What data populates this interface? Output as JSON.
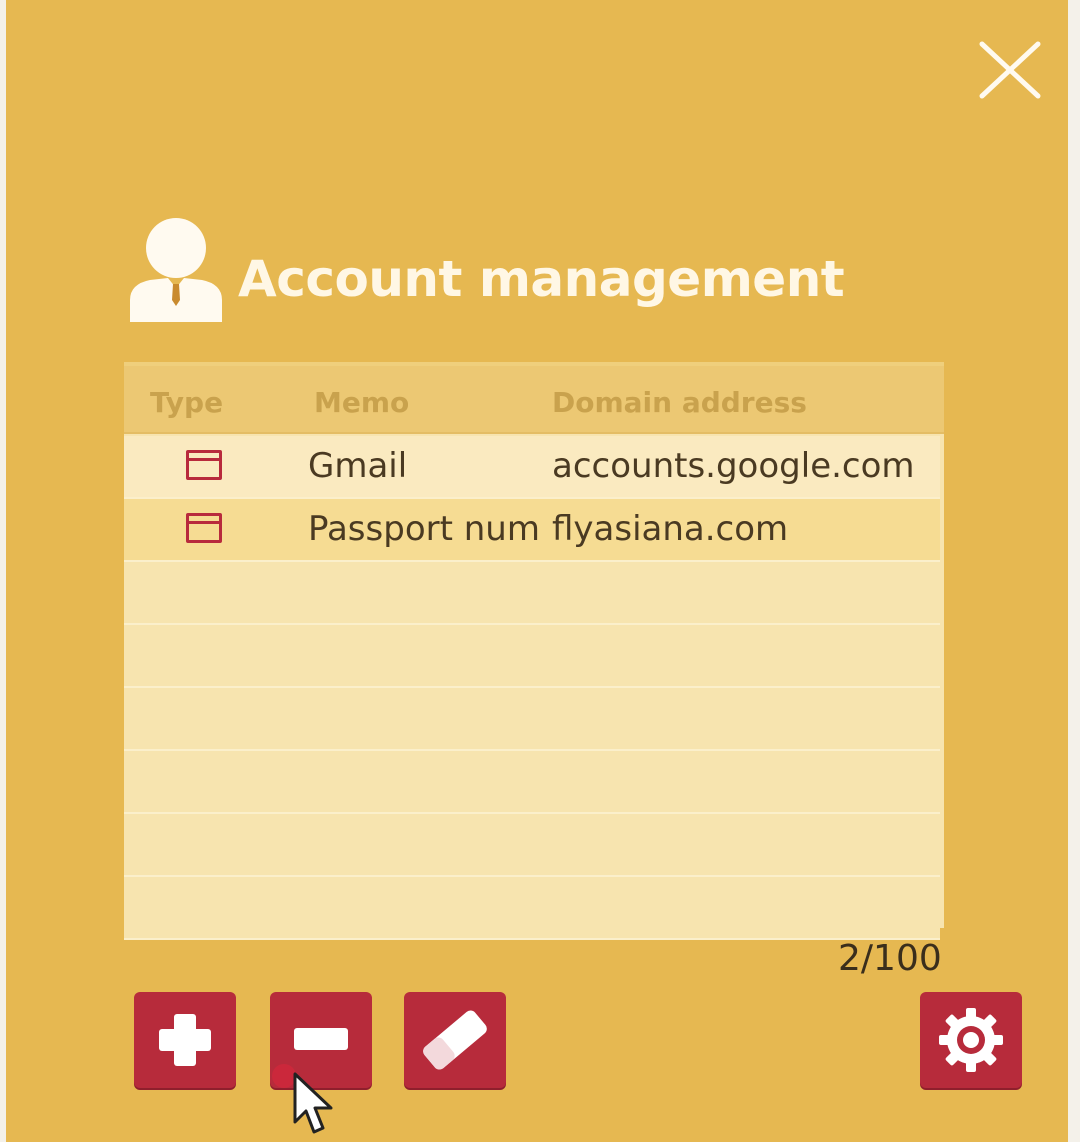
{
  "window": {
    "title": "Account management",
    "background_color": "#e6b851",
    "accent_color": "#b72b3b"
  },
  "table": {
    "columns": [
      "Type",
      "Memo",
      "Domain address"
    ],
    "rows": [
      {
        "type_icon": "card-icon",
        "memo": "Gmail",
        "domain": "accounts.google.com"
      },
      {
        "type_icon": "card-icon",
        "memo": "Passport num",
        "domain": "flyasiana.com"
      }
    ]
  },
  "counter": "2/100",
  "toolbar": {
    "add_icon": "plus-icon",
    "remove_icon": "minus-icon",
    "erase_icon": "eraser-icon",
    "settings_icon": "gear-icon"
  },
  "icons": {
    "close": "close-icon",
    "user": "user-icon"
  }
}
